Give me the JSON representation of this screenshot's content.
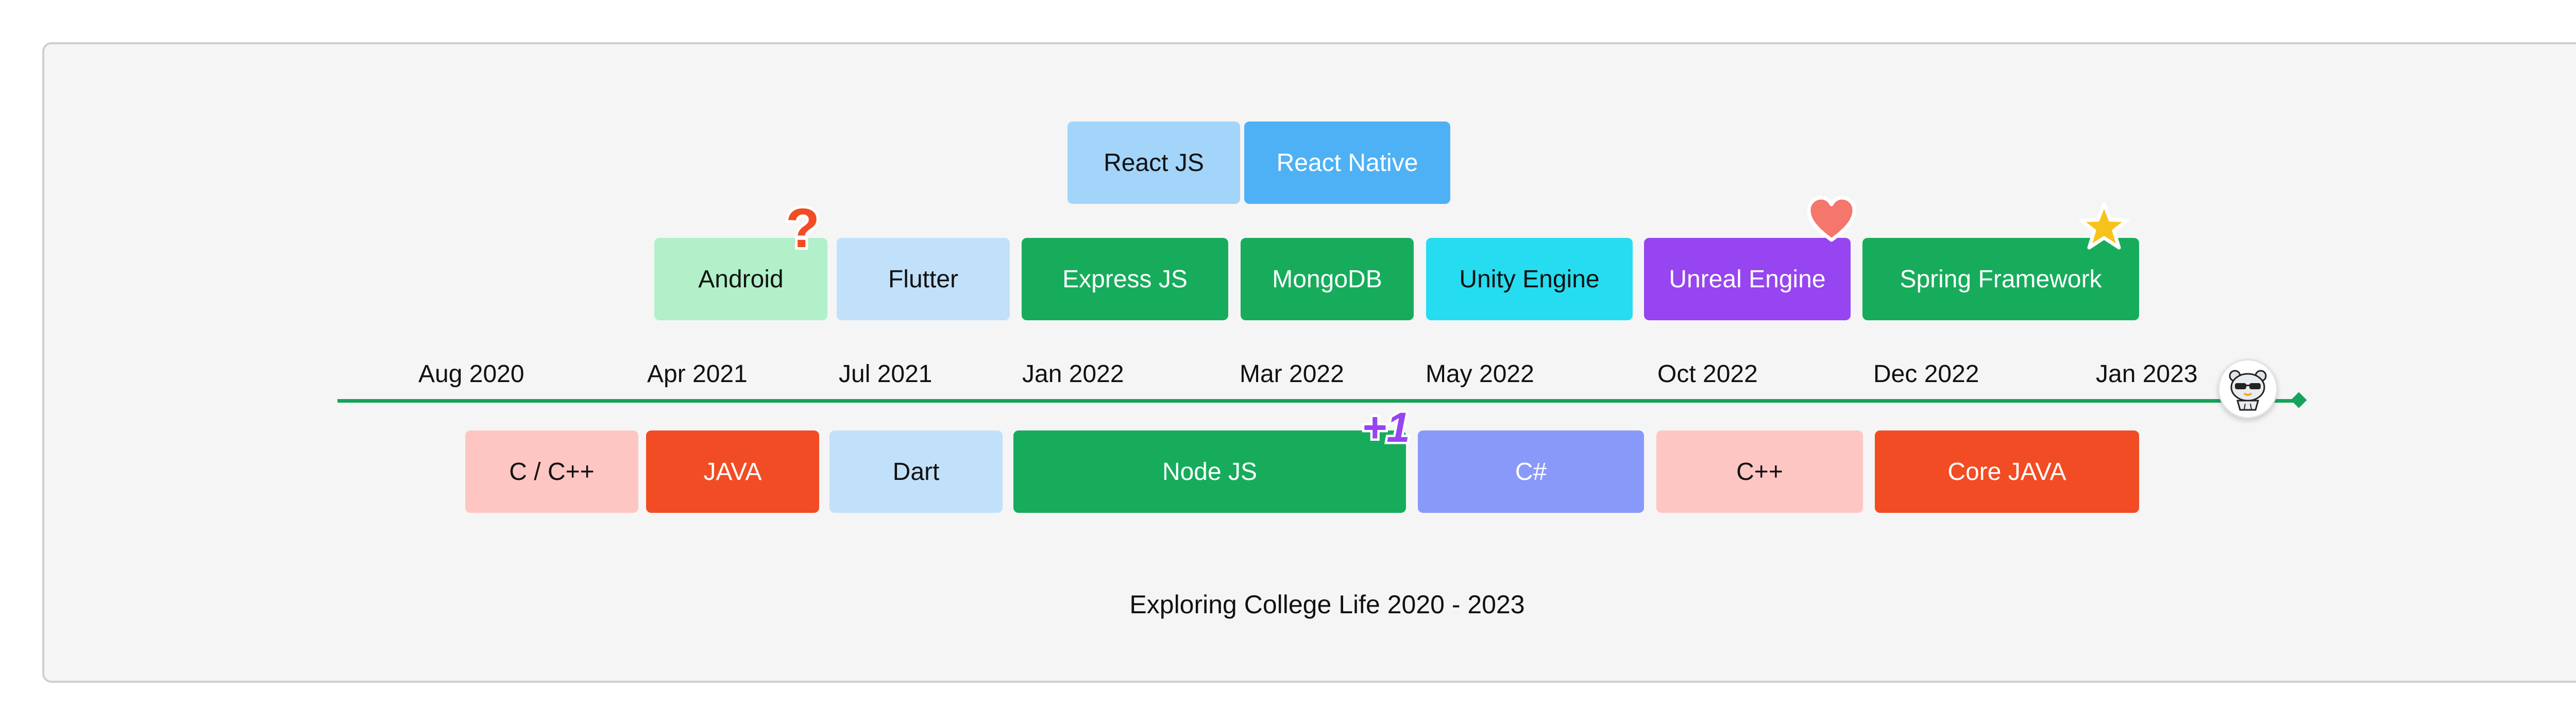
{
  "title": "Exploring College Life 2020 - 2023",
  "colors": {
    "axis": "#16a35a",
    "frame_bg": "#f5f5f5",
    "frame_border": "#cfcfcf"
  },
  "timeline": {
    "dates": [
      "Aug 2020",
      "Apr 2021",
      "Jul 2021",
      "Jan 2022",
      "Mar 2022",
      "May 2022",
      "Oct 2022",
      "Dec 2022",
      "Jan 2023"
    ],
    "top_row": [
      {
        "label": "React JS",
        "bg": "#a3d4fa",
        "fg": "#111111"
      },
      {
        "label": "React Native",
        "bg": "#4eb1f5",
        "fg": "#ffffff"
      }
    ],
    "middle_row": [
      {
        "label": "Android",
        "bg": "#b1f0c9",
        "fg": "#111111"
      },
      {
        "label": "Flutter",
        "bg": "#c1e1fa",
        "fg": "#111111"
      },
      {
        "label": "Express JS",
        "bg": "#17ac5c",
        "fg": "#ffffff"
      },
      {
        "label": "MongoDB",
        "bg": "#17ac5c",
        "fg": "#ffffff"
      },
      {
        "label": "Unity Engine",
        "bg": "#26dcf0",
        "fg": "#111111"
      },
      {
        "label": "Unreal Engine",
        "bg": "#9645f0",
        "fg": "#ffffff"
      },
      {
        "label": "Spring Framework",
        "bg": "#17ac5c",
        "fg": "#ffffff"
      }
    ],
    "bottom_row": [
      {
        "label": "C / C++",
        "bg": "#fec6c2",
        "fg": "#111111"
      },
      {
        "label": "JAVA",
        "bg": "#f24c24",
        "fg": "#ffffff"
      },
      {
        "label": "Dart",
        "bg": "#c1e1fa",
        "fg": "#111111"
      },
      {
        "label": "Node JS",
        "bg": "#17ac5c",
        "fg": "#ffffff"
      },
      {
        "label": "C#",
        "bg": "#8899fa",
        "fg": "#ffffff"
      },
      {
        "label": "C++",
        "bg": "#fec6c2",
        "fg": "#111111"
      },
      {
        "label": "Core JAVA",
        "bg": "#f24c24",
        "fg": "#ffffff"
      }
    ]
  },
  "stickers": {
    "question": {
      "icon": "question-mark-icon",
      "text": "?",
      "color": "#f24c24"
    },
    "heart": {
      "icon": "heart-icon",
      "color": "#f4766c"
    },
    "star": {
      "icon": "star-icon",
      "color": "#f7c31b"
    },
    "plus_one": {
      "icon": "plus-one-icon",
      "text": "+1",
      "color": "#9645f0"
    },
    "avatar": {
      "icon": "avatar-icon"
    }
  }
}
